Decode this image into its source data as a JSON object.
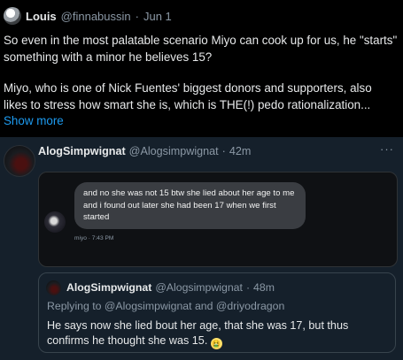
{
  "top_tweet": {
    "display_name": "Louis",
    "handle": "@finnabussin",
    "separator": "·",
    "date": "Jun 1",
    "paragraph1": "So even in the most palatable scenario Miyo can cook up for us, he \"starts\" something with a minor he believes 15?",
    "paragraph2": "Miyo, who is one of Nick Fuentes' biggest donors and supporters, also likes to stress how smart she is, which is THE(!) pedo rationalization...",
    "show_more": "Show more"
  },
  "reply_tweet": {
    "display_name": "AlogSimpwignat",
    "handle": "@Alogsimpwignat",
    "separator": "·",
    "time": "42m",
    "more_icon": "more-horizontal-icon",
    "media": {
      "message": "and no she was not 15 btw she lied about her age to me and i found out later she had been 17 when we first started",
      "meta": "miyo · 7:43 PM"
    },
    "quoted": {
      "display_name": "AlogSimpwignat",
      "handle": "@Alogsimpwignat",
      "separator": "·",
      "time": "48m",
      "replying_to": "Replying to @Alogsimpwignat and @driyodragon",
      "text": "He says now she lied bout her age, that she was 17, but thus confirms he thought she was 15.",
      "emoji": "🤮"
    }
  },
  "colors": {
    "background": "#000000",
    "reply_background": "#15202b",
    "text": "#e7e9ea",
    "muted": "#8b98a5",
    "link": "#1d9bf0"
  }
}
